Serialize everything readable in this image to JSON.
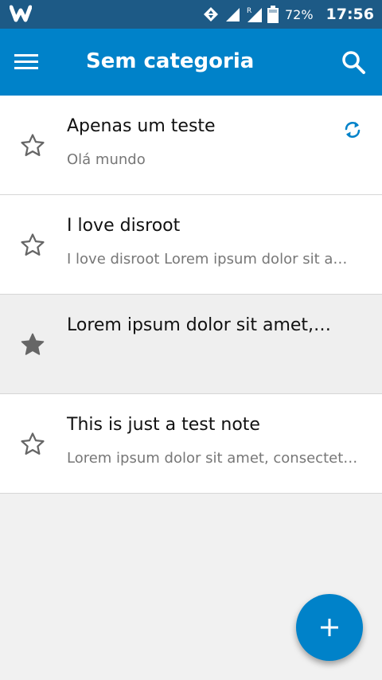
{
  "status_bar": {
    "logo_icon": "w-logo-icon",
    "battery": "72%",
    "time": "17:56"
  },
  "app_bar": {
    "title": "Sem categoria",
    "menu_icon": "hamburger-menu-icon",
    "search_icon": "search-icon"
  },
  "notes": [
    {
      "title": "Apenas um teste",
      "excerpt": "Olá mundo",
      "favorite": false,
      "syncing": true
    },
    {
      "title": "I love disroot",
      "excerpt": "I love disroot Lorem ipsum dolor sit a…",
      "favorite": false,
      "syncing": false
    },
    {
      "title": "Lorem ipsum dolor sit amet,…",
      "excerpt": "",
      "favorite": true,
      "syncing": false
    },
    {
      "title": "This is just a test note",
      "excerpt": "Lorem ipsum dolor sit amet, consectet…",
      "favorite": false,
      "syncing": false
    }
  ],
  "fab": {
    "icon": "plus-icon"
  },
  "colors": {
    "status_bar": "#1d5a86",
    "accent": "#0082c9",
    "background": "#f1f1f1"
  }
}
